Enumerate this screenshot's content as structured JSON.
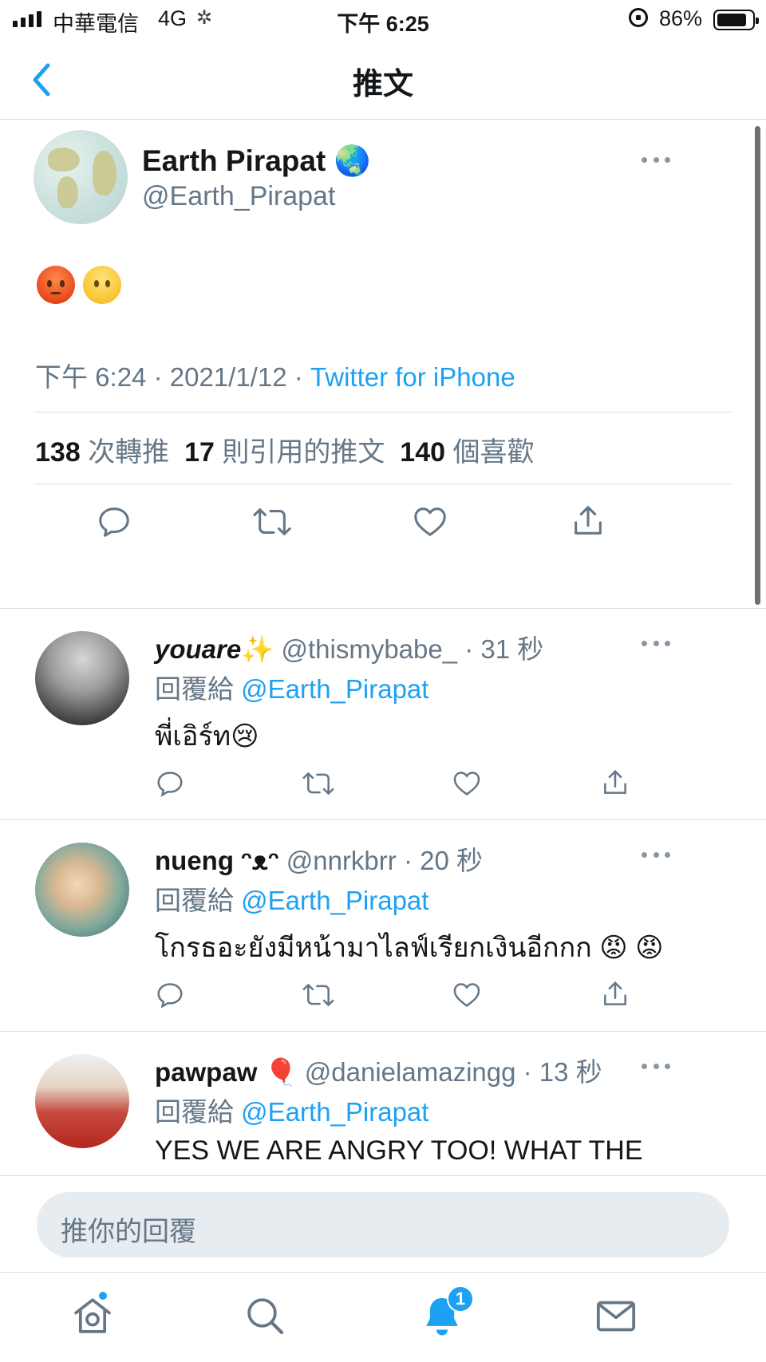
{
  "status_bar": {
    "carrier": "中華電信",
    "network": "4G",
    "time": "下午 6:25",
    "battery": "86%",
    "battery_level": 0.86
  },
  "nav": {
    "title": "推文"
  },
  "tweet": {
    "author_name": "Earth Pirapat",
    "author_emoji": "🌏",
    "handle": "@Earth_Pirapat",
    "content_emojis": [
      "😡",
      "😶"
    ],
    "time": "下午 6:24",
    "date": "2021/1/12",
    "dot": "·",
    "source": "Twitter for iPhone",
    "retweets_count": "138",
    "retweets_label": "次轉推",
    "quotes_count": "17",
    "quotes_label": "則引用的推文",
    "likes_count": "140",
    "likes_label": "個喜歡"
  },
  "reply_prefix": "回覆給",
  "replies": [
    {
      "name": "youare",
      "name_emoji": "✨",
      "handle": "@thismybabe_",
      "time": "· 31 秒",
      "reply_to": "@Earth_Pirapat",
      "text": "พี่เอิร์ท",
      "text_emoji": "😢"
    },
    {
      "name": "nueng ᵔᴥᵔ",
      "name_emoji": "",
      "handle": "@nnrkbrr",
      "time": "· 20 秒",
      "reply_to": "@Earth_Pirapat",
      "text": "โกรธอะยังมีหน้ามาไลฟ์เรียกเงินอีกกก",
      "text_emoji": "😡 😡"
    },
    {
      "name": "pawpaw",
      "name_emoji": "🎈",
      "handle": "@danielamazingg",
      "time": "· 13 秒",
      "reply_to": "@Earth_Pirapat",
      "text": "YES WE ARE ANGRY TOO! WHAT THE",
      "text_emoji": ""
    }
  ],
  "composer": {
    "placeholder": "推你的回覆"
  },
  "tabs": {
    "notifications_badge": "1"
  },
  "colors": {
    "accent": "#1da1f2",
    "secondary_text": "#657786",
    "divider": "#d8dde2",
    "composer_bg": "#e6ecf0"
  },
  "icons": [
    "back-chevron-icon",
    "more-icon",
    "reply-icon",
    "retweet-icon",
    "like-icon",
    "share-icon",
    "home-icon",
    "search-icon",
    "notifications-icon",
    "messages-icon"
  ]
}
